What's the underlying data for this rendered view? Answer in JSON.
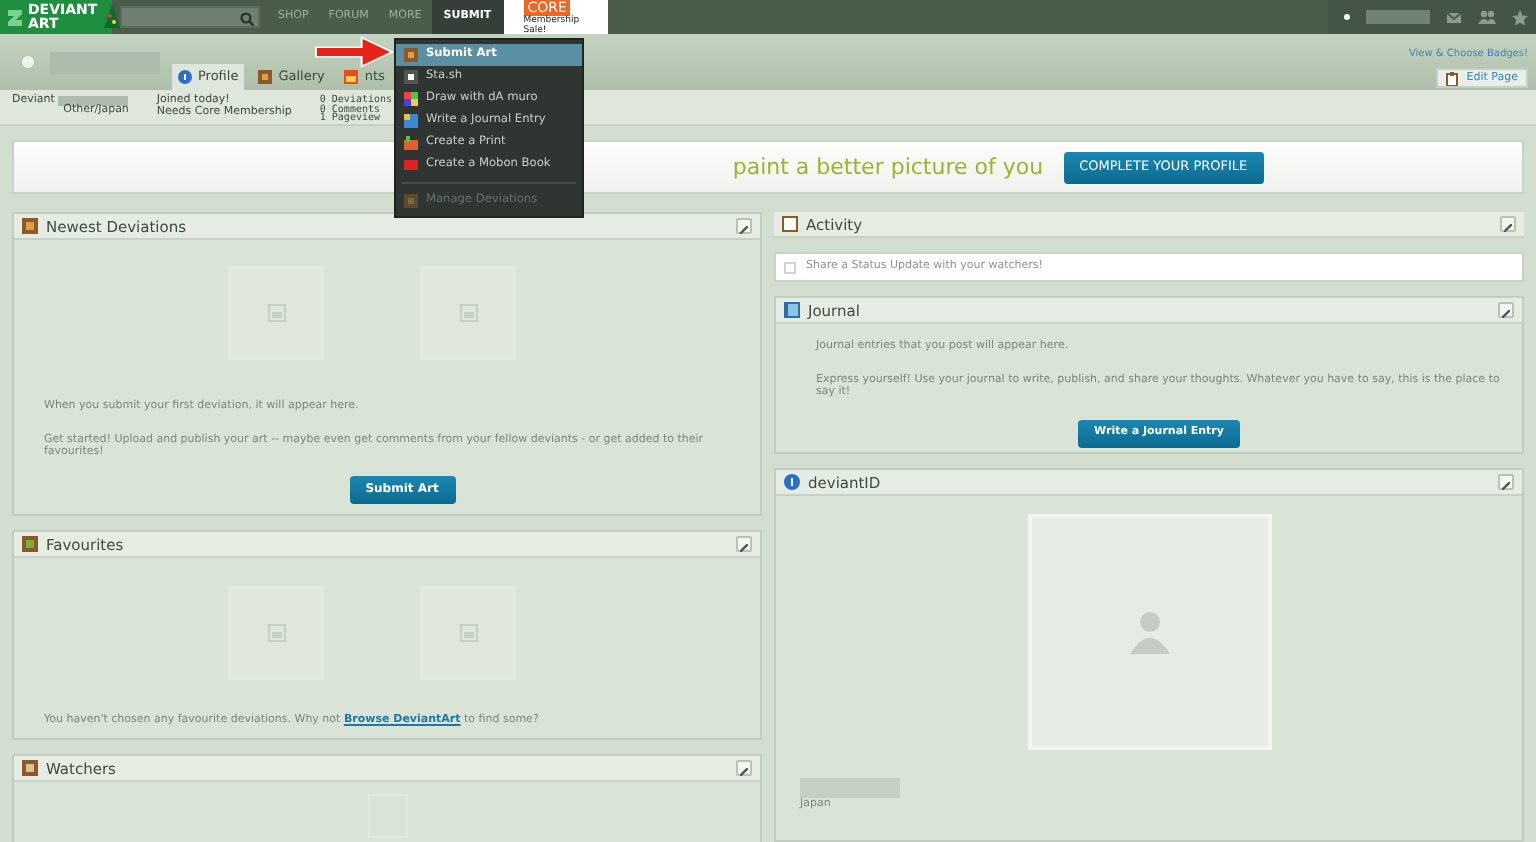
{
  "topbar": {
    "logo": [
      "DEVIANT",
      "ART"
    ],
    "nav": [
      {
        "label": "SHOP",
        "selected": false
      },
      {
        "label": "FORUM",
        "selected": false
      },
      {
        "label": "MORE",
        "selected": false
      },
      {
        "label": "SUBMIT",
        "selected": true
      }
    ],
    "promo": {
      "badge": "CORE",
      "text": [
        "Membership",
        "Sale!"
      ]
    }
  },
  "submit_menu": {
    "items": [
      {
        "label": "Submit Art",
        "selected": true,
        "disabled": false
      },
      {
        "label": "Sta.sh",
        "selected": false,
        "disabled": false
      },
      {
        "label": "Draw with dA muro",
        "selected": false,
        "disabled": false
      },
      {
        "label": "Write a Journal Entry",
        "selected": false,
        "disabled": false
      },
      {
        "label": "Create a Print",
        "selected": false,
        "disabled": false
      },
      {
        "label": "Create a Mobon Book",
        "selected": false,
        "disabled": false
      },
      {
        "label": "Manage Deviations",
        "selected": false,
        "disabled": true
      }
    ]
  },
  "profile_tabs": [
    {
      "label": "Profile",
      "selected": true
    },
    {
      "label": "Gallery",
      "selected": false
    },
    {
      "label": "nts",
      "selected": false
    }
  ],
  "badges_link": "View & Choose Badges!",
  "edit_button": "Edit Page",
  "info": {
    "deviant_label": "Deviant",
    "location": "Other/Japan",
    "joined": [
      "Joined today!",
      "Needs Core Membership"
    ],
    "stats": [
      "0 Deviations",
      "0 Comments",
      "1 Pageview"
    ]
  },
  "banner": {
    "text": "paint a better picture of you",
    "button": "COMPLETE YOUR PROFILE"
  },
  "left_widgets": [
    {
      "kind": "deviations",
      "title": "Newest Deviations",
      "paragraphs": [
        "When you submit your first deviation, it will appear here.",
        "Get started! Upload and publish your art -- maybe even get comments from your fellow deviants - or get added to their favourites!"
      ],
      "button": "Submit Art"
    },
    {
      "kind": "favourites",
      "title": "Favourites",
      "text_before": "You haven't chosen any favourite deviations. Why not ",
      "link": "Browse DeviantArt",
      "text_after": " to find some?"
    },
    {
      "kind": "watchers",
      "title": "Watchers"
    }
  ],
  "right_widgets": [
    {
      "kind": "activity",
      "title": "Activity",
      "placeholder": "Share a Status Update with your watchers!"
    },
    {
      "kind": "journal",
      "title": "Journal",
      "paragraphs": [
        "Journal entries that you post will appear here.",
        "Express yourself! Use your journal to write, publish, and share your thoughts. Whatever you have to say, this is the place to say it!"
      ],
      "button": "Write a Journal Entry"
    },
    {
      "kind": "deviantid",
      "title": "deviantID",
      "location": "Japan"
    }
  ]
}
